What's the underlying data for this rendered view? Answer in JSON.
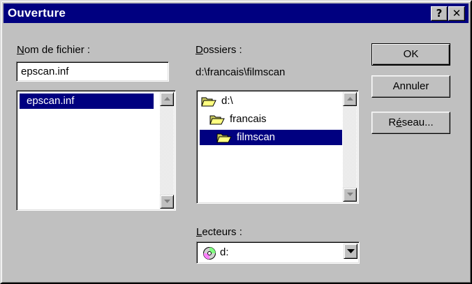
{
  "window": {
    "title": "Ouverture",
    "help_label": "?",
    "close_label": "✕"
  },
  "filename": {
    "label_accel": "N",
    "label_rest": "om de fichier :",
    "value": "epscan.inf",
    "files": [
      "epscan.inf"
    ]
  },
  "folders": {
    "label_accel": "D",
    "label_rest": "ossiers :",
    "current_path": "d:\\francais\\filmscan",
    "tree": [
      "d:\\",
      "francais",
      "filmscan"
    ]
  },
  "drives": {
    "label_accel": "L",
    "label_rest": "ecteurs :",
    "selected": "d:"
  },
  "buttons": {
    "ok": "OK",
    "cancel": "Annuler",
    "network_pre": "R",
    "network_accel": "é",
    "network_post": "seau..."
  },
  "colors": {
    "face": "#c0c0c0",
    "title_bar": "#000080",
    "selection": "#000080",
    "folder": "#ffff80"
  }
}
